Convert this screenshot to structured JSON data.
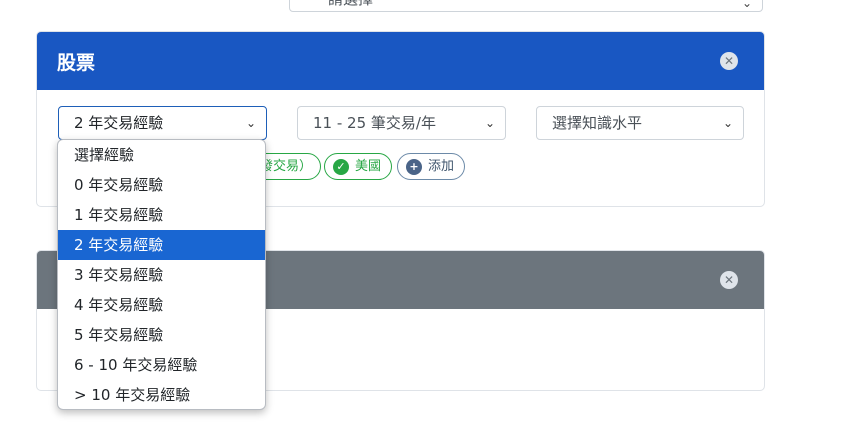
{
  "top_select": {
    "value": "請選擇"
  },
  "stock_card": {
    "title": "股票",
    "experience_select": {
      "value": "2 年交易經驗",
      "options": [
        "選擇經驗",
        "0 年交易經驗",
        "1 年交易經驗",
        "2 年交易經驗",
        "3 年交易經驗",
        "4 年交易經驗",
        "5 年交易經驗",
        "6 - 10 年交易經驗",
        "> 10 年交易經驗"
      ],
      "highlighted_index": 3
    },
    "frequency_select": {
      "value": "11 - 25 筆交易/年"
    },
    "knowledge_select": {
      "value": "選擇知識水平"
    },
    "tags": [
      {
        "label": "發交易）",
        "icon": "check-icon"
      },
      {
        "label": "美國",
        "icon": "check-icon"
      }
    ],
    "add_label": "添加"
  },
  "second_card": {
    "title": ""
  },
  "colors": {
    "primary_header": "#1957c2",
    "secondary_header": "#6c757d",
    "success": "#28a745",
    "option_highlight": "#1966d2"
  }
}
